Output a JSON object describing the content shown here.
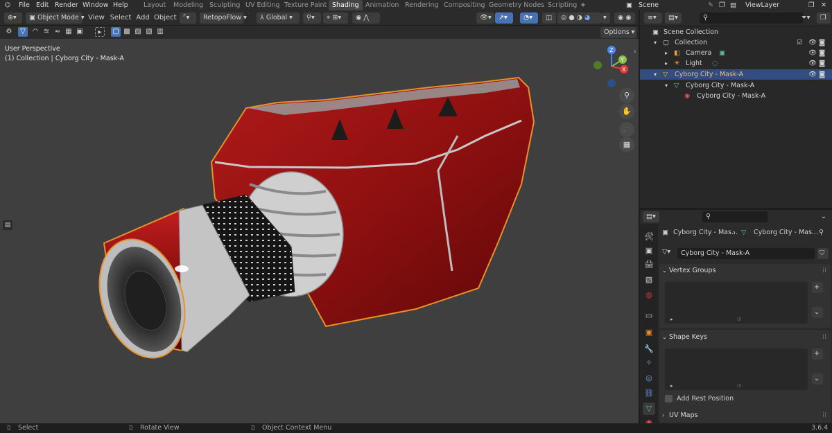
{
  "topbar": {
    "menus": [
      "File",
      "Edit",
      "Render",
      "Window",
      "Help"
    ],
    "workspaces": [
      "Layout",
      "Modeling",
      "Sculpting",
      "UV Editing",
      "Texture Paint",
      "Shading",
      "Animation",
      "Rendering",
      "Compositing",
      "Geometry Nodes",
      "Scripting"
    ],
    "active_workspace": "Shading",
    "scene_label": "Scene",
    "viewlayer_label": "ViewLayer"
  },
  "viewport_header": {
    "mode": "Object Mode",
    "menus": [
      "View",
      "Select",
      "Add",
      "Object"
    ],
    "addon": "RetopoFlow",
    "orientation": "Global",
    "options_label": "Options"
  },
  "viewport": {
    "perspective": "User Perspective",
    "collection_info": "(1) Collection | Cyborg City - Mask-A",
    "gizmo_axes": {
      "z": "Z",
      "y": "Y",
      "x": "X"
    }
  },
  "outliner": {
    "search_placeholder": "",
    "rows": [
      {
        "label": "Scene Collection",
        "indent": 0
      },
      {
        "label": "Collection",
        "indent": 1
      },
      {
        "label": "Camera",
        "indent": 2
      },
      {
        "label": "Light",
        "indent": 2
      },
      {
        "label": "Cyborg City - Mask-A",
        "indent": 2,
        "selected": true
      },
      {
        "label": "Cyborg City - Mask-A",
        "indent": 3
      },
      {
        "label": "Cyborg City - Mask-A",
        "indent": 4
      }
    ]
  },
  "properties": {
    "breadcrumb_object": "Cyborg City - Mas...",
    "breadcrumb_data": "Cyborg City - Mas...",
    "mesh_name": "Cyborg City - Mask-A",
    "panels": {
      "vertex_groups": "Vertex Groups",
      "shape_keys": "Shape Keys",
      "add_rest_position": "Add Rest Position",
      "uv_maps": "UV Maps"
    }
  },
  "statusbar": {
    "select": "Select",
    "rotate": "Rotate View",
    "context": "Object Context Menu",
    "version": "3.6.4"
  },
  "colors": {
    "accent": "#4772b3",
    "selection": "#334d80",
    "mask_red": "#9b1414",
    "outline_orange": "#e8912a"
  }
}
